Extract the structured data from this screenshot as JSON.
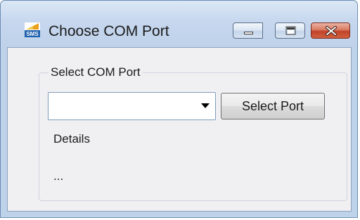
{
  "window": {
    "title": "Choose COM Port",
    "icon": "sms-app-icon",
    "controls": {
      "minimize": "minimize-icon",
      "maximize": "maximize-icon",
      "close": "close-icon"
    }
  },
  "group": {
    "legend": "Select COM Port",
    "combo": {
      "value": "",
      "icon": "dropdown-arrow-icon"
    },
    "select_button_label": "Select Port",
    "details_label": "Details",
    "details_value": "..."
  },
  "colors": {
    "frame": "#bed2ea",
    "client": "#f0eff2",
    "close_button": "#c0432a"
  }
}
